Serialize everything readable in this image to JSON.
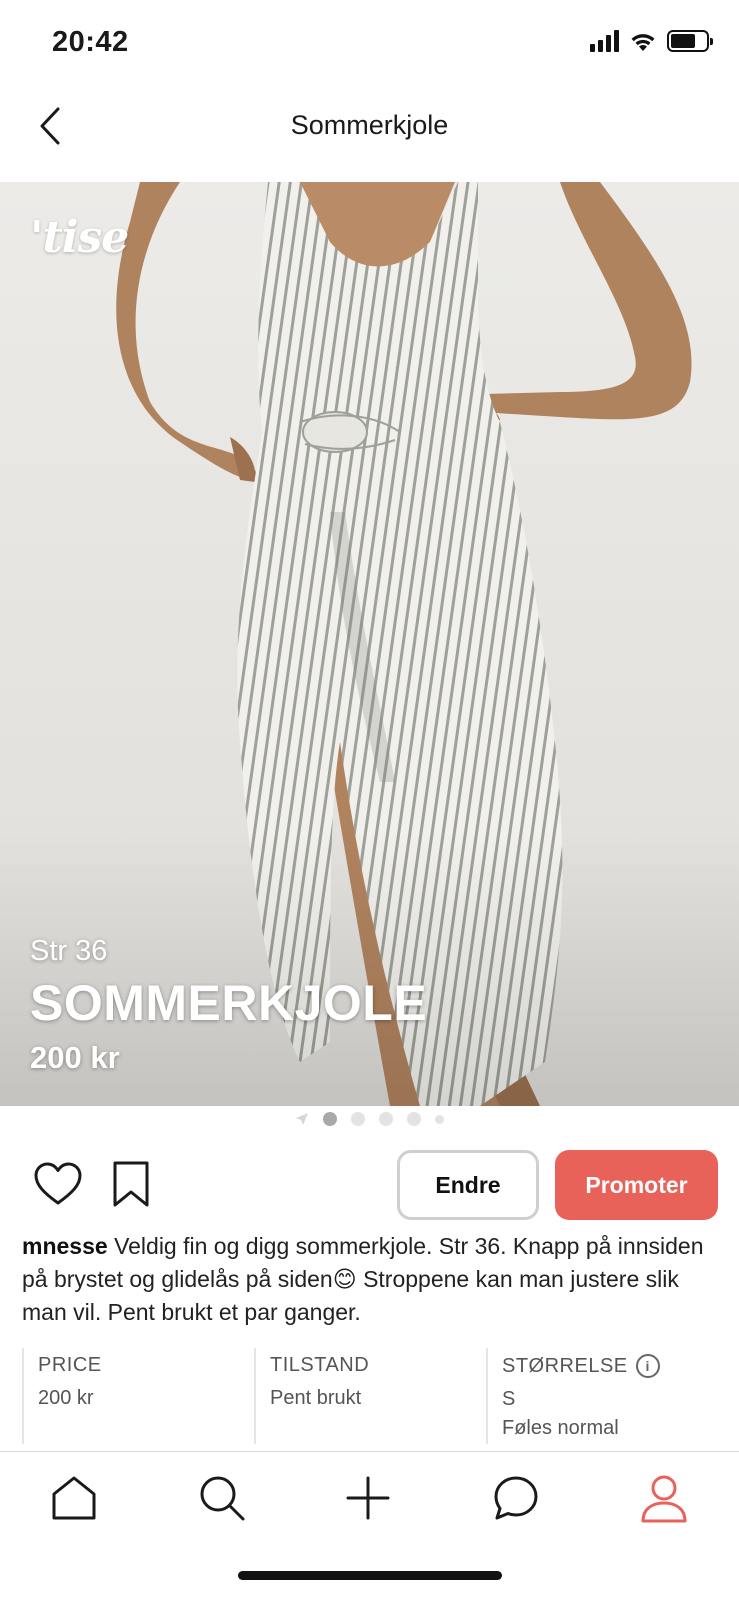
{
  "status_bar": {
    "time": "20:42"
  },
  "header": {
    "title": "Sommerkjole"
  },
  "hero": {
    "brand": "'tise",
    "size_label": "Str 36",
    "title": "SOMMERKJOLE",
    "price": "200 kr"
  },
  "carousel": {
    "total_dots": 5,
    "active_index": 0
  },
  "actions": {
    "edit_label": "Endre",
    "promote_label": "Promoter"
  },
  "description": {
    "username": "mnesse",
    "text": "Veldig fin og digg sommerkjole. Str 36. Knapp på innsiden på brystet og glidelås på siden😊 Stroppene kan man justere slik man vil. Pent brukt et par ganger."
  },
  "details": {
    "price": {
      "label": "PRICE",
      "value": "200 kr"
    },
    "condition": {
      "label": "TILSTAND",
      "value": "Pent brukt"
    },
    "size": {
      "label": "STØRRELSE",
      "value": "S",
      "fit": "Føles normal"
    }
  },
  "tab_bar": {
    "tabs": [
      "home-icon",
      "search-icon",
      "plus-icon",
      "chat-icon",
      "profile-icon"
    ],
    "active": "profile-icon"
  },
  "colors": {
    "accent": "#e8625a",
    "active_tab": "#e8625a",
    "inactive_tab": "#1a1a1a"
  }
}
